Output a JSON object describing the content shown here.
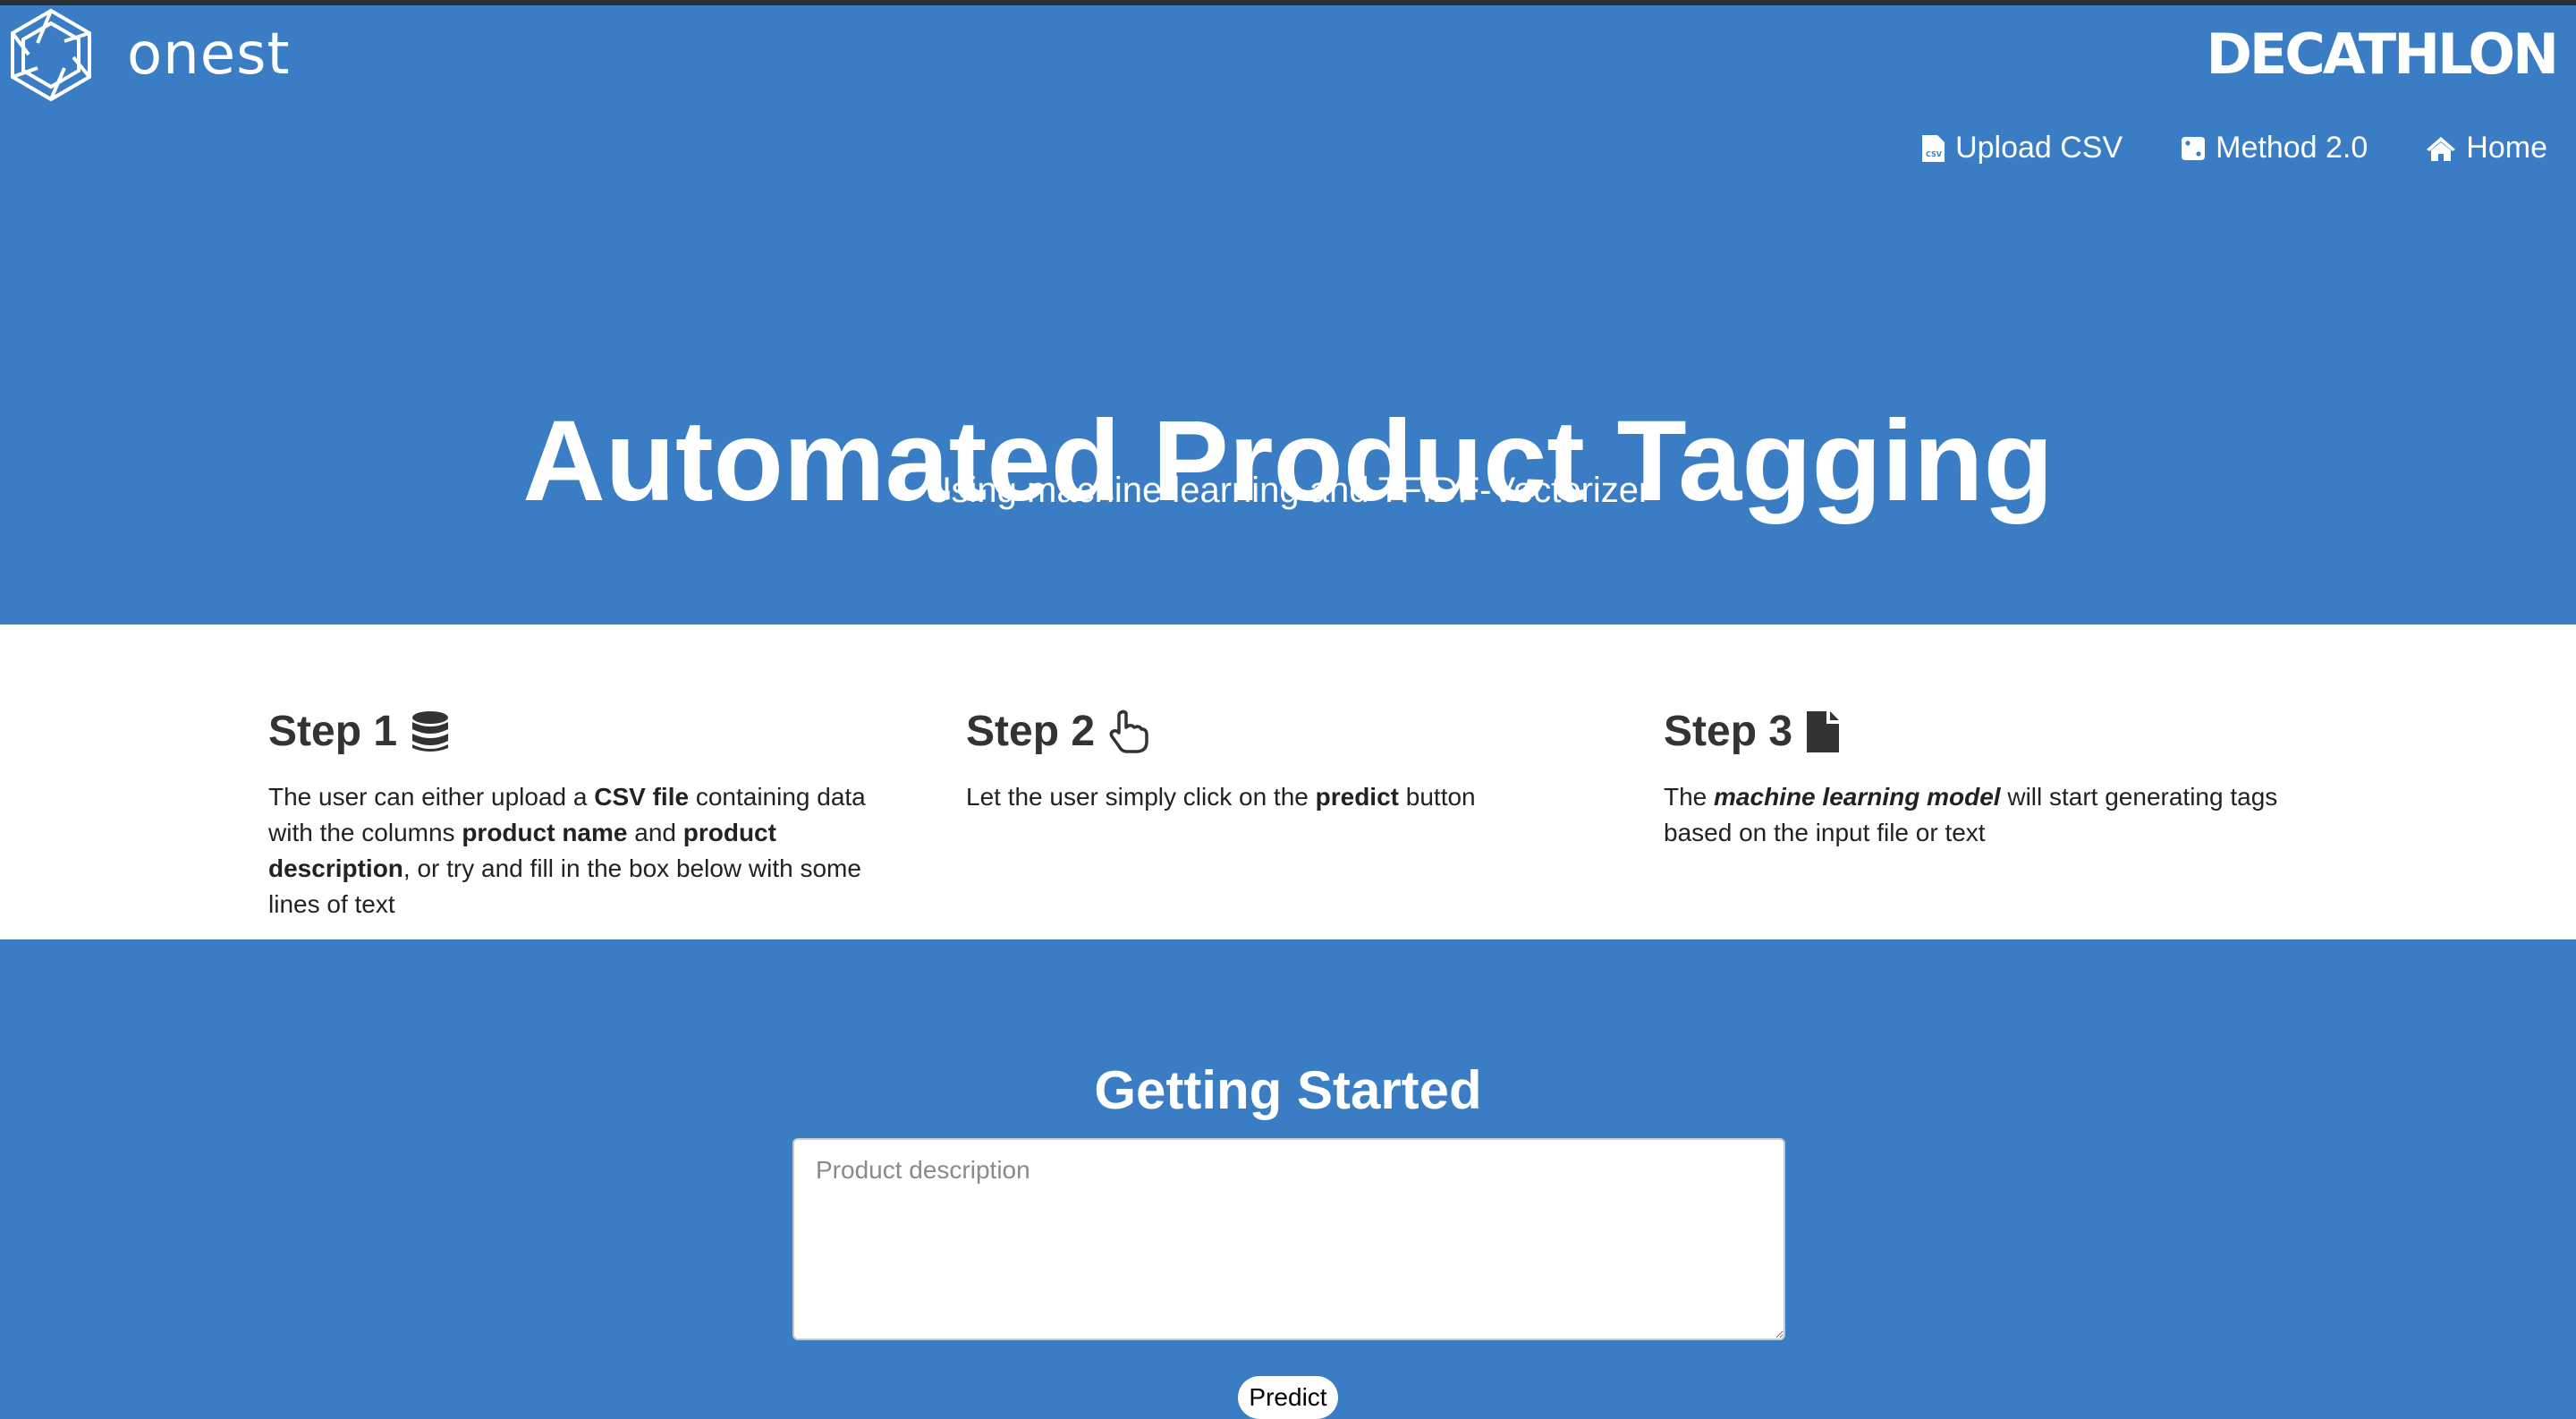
{
  "header": {
    "brand_left": "onest",
    "brand_right": "DECATHLON",
    "nav": [
      {
        "label": "Upload CSV",
        "icon": "csv-file-icon"
      },
      {
        "label": "Method 2.0",
        "icon": "dice-icon"
      },
      {
        "label": "Home",
        "icon": "home-icon"
      }
    ]
  },
  "hero": {
    "title": "Automated Product Tagging",
    "subtitle": "Using machine learning and TFIDF-Vectorizer"
  },
  "steps": [
    {
      "title": "Step 1",
      "icon": "database-icon",
      "p1": "The user can either upload a ",
      "b1": "CSV file",
      "p2": " containing data with the columns ",
      "b2": "product name",
      "p3": " and ",
      "b3": "product description",
      "p4": ", or try and fill in the box below with some lines of text"
    },
    {
      "title": "Step 2",
      "icon": "pointing-hand-icon",
      "p1": "Let the user simply click on the ",
      "b1": "predict",
      "p2": " button"
    },
    {
      "title": "Step 3",
      "icon": "file-icon",
      "p1": "The ",
      "b1": "machine learning model",
      "p2": " will start generating tags based on the input file or text"
    }
  ],
  "getting_started": {
    "heading": "Getting Started",
    "placeholder": "Product description",
    "button": "Predict"
  },
  "colors": {
    "primary_blue": "#3a7dc4",
    "white": "#ffffff"
  }
}
